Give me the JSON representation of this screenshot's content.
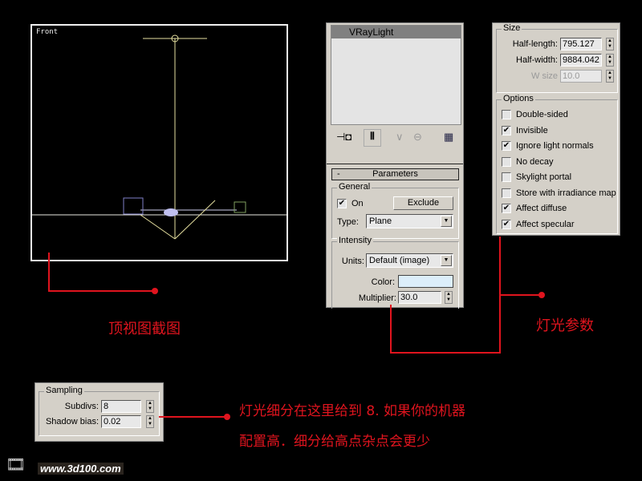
{
  "viewport": {
    "label": "Front"
  },
  "annotations": {
    "top_view": "顶视图截图",
    "light_params": "灯光参数",
    "subdiv_line1": "灯光细分在这里给到 8. 如果你的机器",
    "subdiv_line2": "配置高．细分给高点杂点会更少"
  },
  "modifier_panel": {
    "object_name": "VRayLight",
    "rollout_title": "Parameters",
    "rollout_toggle": "-",
    "general": {
      "title": "General",
      "on_label": "On",
      "on_checked": true,
      "exclude_label": "Exclude",
      "type_label": "Type:",
      "type_value": "Plane"
    },
    "intensity": {
      "title": "Intensity",
      "units_label": "Units:",
      "units_value": "Default (image)",
      "color_label": "Color:",
      "color_value": "#dceefa",
      "multiplier_label": "Multiplier:",
      "multiplier_value": "30.0"
    }
  },
  "size_panel": {
    "title": "Size",
    "half_length_label": "Half-length:",
    "half_length_value": "795.127",
    "half_width_label": "Half-width:",
    "half_width_value": "9884.042",
    "w_size_label": "W size",
    "w_size_value": "10.0"
  },
  "options": {
    "title": "Options",
    "items": [
      {
        "label": "Double-sided",
        "checked": false
      },
      {
        "label": "Invisible",
        "checked": true
      },
      {
        "label": "Ignore light normals",
        "checked": true
      },
      {
        "label": "No decay",
        "checked": false
      },
      {
        "label": "Skylight portal",
        "checked": false
      },
      {
        "label": "Store with irradiance map",
        "checked": false
      },
      {
        "label": "Affect diffuse",
        "checked": true
      },
      {
        "label": "Affect specular",
        "checked": true
      }
    ]
  },
  "sampling": {
    "title": "Sampling",
    "subdivs_label": "Subdivs:",
    "subdivs_value": "8",
    "shadow_bias_label": "Shadow bias:",
    "shadow_bias_value": "0.02"
  },
  "logo": {
    "text": "www.3d100.com"
  },
  "colors": {
    "accent": "#e0141e"
  }
}
